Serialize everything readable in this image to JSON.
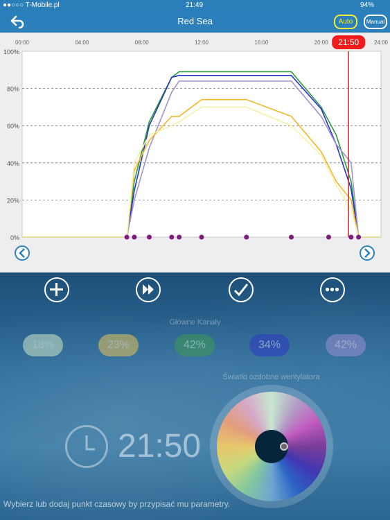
{
  "status": {
    "carrier": "●●○○○ T-Mobile.pl",
    "time": "21:49",
    "battery": "94%"
  },
  "nav": {
    "title": "Red Sea",
    "auto_label": "Auto",
    "manual_label": "Manual",
    "back_icon": "back-arrow-icon"
  },
  "chart_data": {
    "type": "line",
    "xlabel": "",
    "ylabel": "",
    "x_ticks": [
      "00:00",
      "04:00",
      "08:00",
      "12:00",
      "16:00",
      "20:00",
      "24:00"
    ],
    "y_ticks": [
      "0%",
      "20%",
      "40%",
      "60%",
      "80%",
      "100%"
    ],
    "xlim": [
      0,
      24
    ],
    "ylim": [
      0,
      100
    ],
    "current_time_marker": {
      "label": "21:50",
      "x": 21.83
    },
    "grid": true,
    "series": [
      {
        "color": "#2e9b3e",
        "x": [
          0,
          7,
          7.5,
          8.5,
          10,
          10.5,
          12,
          15,
          18,
          20,
          21,
          22,
          22.5,
          24
        ],
        "values": [
          0,
          0,
          30,
          62,
          86,
          89,
          89,
          89,
          89,
          70,
          55,
          30,
          0,
          0
        ]
      },
      {
        "color": "#2634c6",
        "x": [
          0,
          7,
          7.5,
          8.5,
          10,
          10.5,
          12,
          15,
          18,
          20,
          21,
          22,
          22.5,
          24
        ],
        "values": [
          0,
          0,
          25,
          60,
          86,
          87,
          87,
          87,
          87,
          69,
          50,
          26,
          0,
          0
        ]
      },
      {
        "color": "#a091d2",
        "x": [
          0,
          7,
          7.5,
          8.5,
          10,
          10.5,
          12,
          15,
          18,
          20,
          21,
          22,
          22.5,
          24
        ],
        "values": [
          0,
          0,
          20,
          48,
          78,
          84,
          84,
          84,
          84,
          65,
          50,
          40,
          0,
          0
        ]
      },
      {
        "color": "#f2b729",
        "x": [
          0,
          7,
          7.5,
          8.5,
          10,
          10.5,
          12,
          15,
          18,
          20,
          21,
          22,
          22.5,
          24
        ],
        "values": [
          0,
          0,
          36,
          52,
          65,
          65,
          74,
          74,
          65,
          46,
          30,
          20,
          0,
          0
        ]
      },
      {
        "color": "#f6f1a9",
        "x": [
          0,
          7,
          7.5,
          8.5,
          10,
          10.5,
          12,
          15,
          18,
          20,
          21,
          22,
          22.5,
          24
        ],
        "values": [
          0,
          0,
          40,
          55,
          60,
          62,
          70,
          70,
          60,
          44,
          28,
          15,
          0,
          0
        ]
      }
    ],
    "time_points_x": [
      7,
      7.5,
      8.5,
      10,
      10.5,
      12,
      15,
      18,
      20.5,
      22,
      22.5
    ]
  },
  "toolbar": {
    "add_icon": "plus-circle-icon",
    "forward_icon": "fast-forward-circle-icon",
    "confirm_icon": "check-circle-icon",
    "more_icon": "more-circle-icon"
  },
  "channels": {
    "title": "Główne Kanały",
    "values": [
      {
        "label": "18%",
        "color": "#cfe7c7"
      },
      {
        "label": "23%",
        "color": "#e8c35a"
      },
      {
        "label": "42%",
        "color": "#3f9a52"
      },
      {
        "label": "34%",
        "color": "#2f39c4"
      },
      {
        "label": "42%",
        "color": "#9b8fd0"
      }
    ]
  },
  "fan_light": {
    "title": "Światło ozdobne wentylatora"
  },
  "clock": {
    "time": "21:50"
  },
  "hint": "Wybierz lub dodaj punkt czasowy by przypisać mu parametry."
}
